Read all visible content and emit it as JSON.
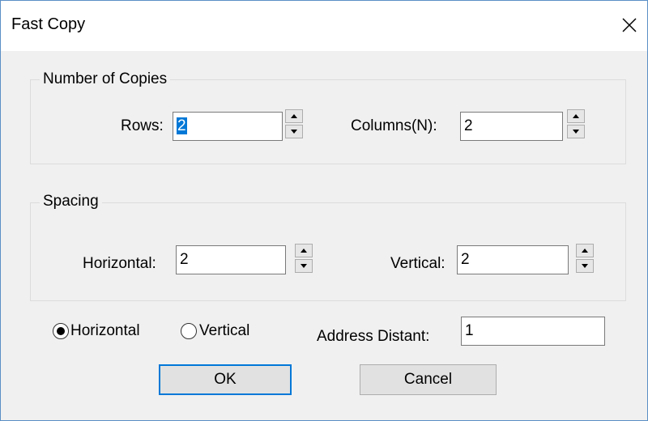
{
  "window": {
    "title": "Fast Copy"
  },
  "copies": {
    "legend": "Number of Copies",
    "rows_label": "Rows:",
    "rows_value": "2",
    "columns_label": "Columns(N):",
    "columns_value": "2"
  },
  "spacing": {
    "legend": "Spacing",
    "horizontal_label": "Horizontal:",
    "horizontal_value": "2",
    "vertical_label": "Vertical:",
    "vertical_value": "2"
  },
  "direction": {
    "options": [
      {
        "label": "Horizontal",
        "selected": true
      },
      {
        "label": "Vertical",
        "selected": false
      }
    ]
  },
  "address": {
    "label": "Address Distant:",
    "value": "1"
  },
  "buttons": {
    "ok": "OK",
    "cancel": "Cancel"
  },
  "colors": {
    "accent": "#0078d7",
    "window_border": "#5b8fc7",
    "dialog_bg": "#f0f0f0"
  }
}
